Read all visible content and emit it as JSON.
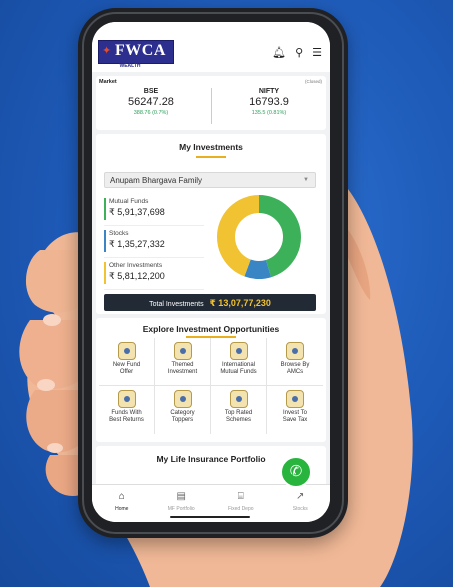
{
  "brand": {
    "logo_text": "FWCA",
    "logo_sub": "WEALTH"
  },
  "header_icons": [
    "bell-icon",
    "search-icon",
    "menu-icon"
  ],
  "market": {
    "title": "Market",
    "status": "(Closed)",
    "bse": {
      "name": "BSE",
      "value": "56247.28",
      "change": "388.76  (0.7%)"
    },
    "nifty": {
      "name": "NIFTY",
      "value": "16793.9",
      "change": "135.5  (0.81%)"
    }
  },
  "investments": {
    "title": "My Investments",
    "family": "Anupam Bhargava Family",
    "items": [
      {
        "name": "Mutual Funds",
        "value": "₹ 5,91,37,698",
        "color": "#3db05a"
      },
      {
        "name": "Stocks",
        "value": "₹ 1,35,27,332",
        "color": "#3a86c4"
      },
      {
        "name": "Other Investments",
        "value": "₹ 5,81,12,200",
        "color": "#f1c232"
      }
    ],
    "total_label": "Total Investments",
    "total_value": "₹ 13,07,77,230"
  },
  "explore": {
    "title": "Explore Investment Opportunities",
    "items": [
      {
        "line1": "New Fund",
        "line2": "Offer"
      },
      {
        "line1": "Themed",
        "line2": "Investment"
      },
      {
        "line1": "International",
        "line2": "Mutual Funds"
      },
      {
        "line1": "Browse By",
        "line2": "AMCs"
      },
      {
        "line1": "Funds With",
        "line2": "Best Returns"
      },
      {
        "line1": "Category",
        "line2": "Toppers"
      },
      {
        "line1": "Top Rated",
        "line2": "Schemes"
      },
      {
        "line1": "Invest To",
        "line2": "Save Tax"
      }
    ]
  },
  "life": {
    "title": "My Life Insurance Portfolio"
  },
  "nav": [
    {
      "label": "Home",
      "icon": "home-icon"
    },
    {
      "label": "MF Portfolio",
      "icon": "portfolio-icon"
    },
    {
      "label": "Fixed Depo",
      "icon": "bank-icon"
    },
    {
      "label": "Stocks",
      "icon": "chart-icon"
    }
  ]
}
